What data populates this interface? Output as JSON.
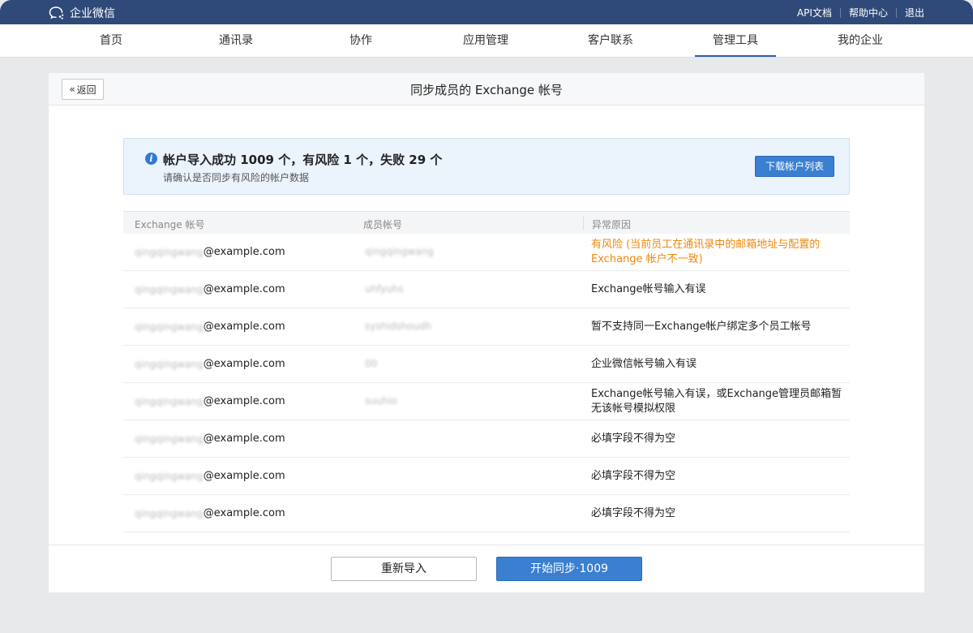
{
  "topbar": {
    "brand": "企业微信",
    "links": [
      "API文档",
      "帮助中心",
      "退出"
    ]
  },
  "nav": {
    "items": [
      "首页",
      "通讯录",
      "协作",
      "应用管理",
      "客户联系",
      "管理工具",
      "我的企业"
    ],
    "active": "管理工具"
  },
  "panel": {
    "back_label": "返回",
    "title": "同步成员的 Exchange 帐号"
  },
  "notice": {
    "title": "帐户导入成功 1009 个，有风险 1 个，失败 29 个",
    "subtitle": "请确认是否同步有风险的帐户数据",
    "download_label": "下载帐户列表"
  },
  "table": {
    "headers": [
      "Exchange 帐号",
      "成员帐号",
      "异常原因"
    ],
    "rows": [
      {
        "account_blurred": "qingqingwang",
        "domain": "@example.com",
        "member": "qingqingwang",
        "reason": "有风险 (当前员工在通讯录中的邮箱地址与配置的 Exchange 帐户不一致)",
        "risk": true
      },
      {
        "account_blurred": "qingqingwang",
        "domain": "@example.com",
        "member": "uhfyuhs",
        "reason": "Exchange帐号输入有误",
        "risk": false
      },
      {
        "account_blurred": "qingqingwang",
        "domain": "@example.com",
        "member": "syshidshoudh",
        "reason": "暂不支持同一Exchange帐户绑定多个员工帐号",
        "risk": false
      },
      {
        "account_blurred": "qingqingwang",
        "domain": "@example.com",
        "member": "00",
        "reason": "企业微信帐号输入有误",
        "risk": false
      },
      {
        "account_blurred": "qingqingwang",
        "domain": "@example.com",
        "member": "suuhio",
        "reason": "Exchange帐号输入有误，或Exchange管理员邮箱暂无该帐号模拟权限",
        "risk": false
      },
      {
        "account_blurred": "qingqingwang",
        "domain": "@example.com",
        "member": "",
        "reason": "必填字段不得为空",
        "risk": false
      },
      {
        "account_blurred": "qingqingwang",
        "domain": "@example.com",
        "member": "",
        "reason": "必填字段不得为空",
        "risk": false
      },
      {
        "account_blurred": "qingqingwang",
        "domain": "@example.com",
        "member": "",
        "reason": "必填字段不得为空",
        "risk": false
      }
    ]
  },
  "footer": {
    "reimport_label": "重新导入",
    "sync_label": "开始同步·1009"
  },
  "colors": {
    "topbar": "#2f4a78",
    "primary": "#3a7fd0",
    "risk": "#f0880a",
    "notice_bg": "#ebf3fd"
  }
}
